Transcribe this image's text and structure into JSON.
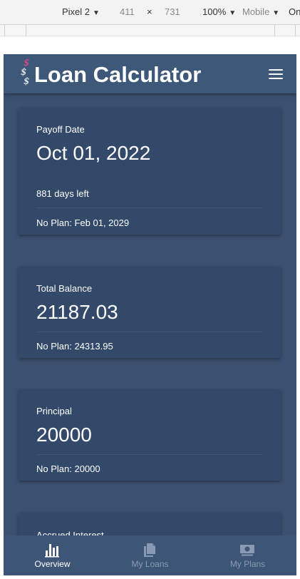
{
  "devtools": {
    "device": "Pixel 2",
    "width": "411",
    "times": "×",
    "height": "731",
    "zoom": "100%",
    "mode": "Mobile",
    "extra": "On"
  },
  "app": {
    "title": "Loan Calculator",
    "logo_glyph": "$"
  },
  "cards": [
    {
      "label": "Payoff Date",
      "value": "Oct 01, 2022",
      "detail": "881 days left",
      "no_plan": "No Plan: Feb 01, 2029"
    },
    {
      "label": "Total Balance",
      "value": "21187.03",
      "no_plan": "No Plan: 24313.95"
    },
    {
      "label": "Principal",
      "value": "20000",
      "no_plan": "No Plan: 20000"
    },
    {
      "label": "Accrued Interest"
    }
  ],
  "nav": [
    {
      "label": "Overview",
      "icon": "bar-chart-icon",
      "active": true
    },
    {
      "label": "My Loans",
      "icon": "documents-icon",
      "active": false
    },
    {
      "label": "My Plans",
      "icon": "money-icon",
      "active": false
    }
  ],
  "colors": {
    "background": "#3c5070",
    "card": "#32496a",
    "appbar": "#3e5879",
    "logo_pink": "#ec4d8a",
    "active_nav": "#ffffff",
    "inactive_nav": "#8a9ab3"
  }
}
